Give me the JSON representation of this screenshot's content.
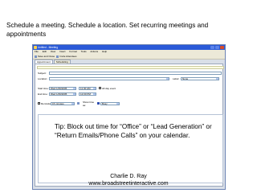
{
  "slide": {
    "heading": "Schedule a meeting. Schedule a location. Set recurring meetings and appointments",
    "tip": "Tip: Block out time for “Office” or “Lead Generation” or “Return Emails/Phone Calls” on your calendar.",
    "presenter_name": "Charlie D. Ray",
    "presenter_url": "www.broadstreetinteractive.com"
  },
  "screenshot": {
    "window_title": "Untitled - Meeting",
    "menu": [
      "File",
      "Edit",
      "View",
      "Insert",
      "Format",
      "Tools",
      "Actions",
      "Help"
    ],
    "toolbar": [
      "Save and Close",
      "Invite Attendees"
    ],
    "tabs": [
      "Appointment",
      "Scheduling"
    ],
    "form": {
      "subject_label": "Subject:",
      "location_label": "Location:",
      "label_label": "Label:",
      "label_value": "None",
      "start_label": "Start time:",
      "start_date": "Wed 1/26/2005",
      "start_time": "11:30 AM",
      "end_label": "End time:",
      "end_date": "Wed 1/26/2005",
      "end_time": "12:00 PM",
      "all_day": "All day event",
      "reminder_label": "Reminder:",
      "reminder_value": "15 minutes",
      "show_time_label": "Show time as:",
      "show_time_value": "Busy"
    }
  },
  "colors": {
    "title_bar": "#2a5ad8",
    "window_border": "#6d84b4",
    "chrome": "#ece9d8"
  }
}
